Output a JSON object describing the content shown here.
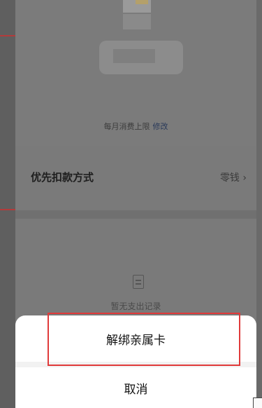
{
  "background": {
    "monthly_limit_label": "每月消费上限",
    "edit_link": "修改",
    "priority_label": "优先扣款方式",
    "priority_value": "零钱",
    "chevron": "chevron-right-icon",
    "empty_icon": "document-icon",
    "empty_text": "暂无支出记录"
  },
  "sheet": {
    "unbind_label": "解绑亲属卡",
    "cancel_label": "取消"
  },
  "colors": {
    "overlay": "#6a6a6a",
    "highlight": "#e03a3a",
    "edit_link": "#2a3a5a"
  }
}
